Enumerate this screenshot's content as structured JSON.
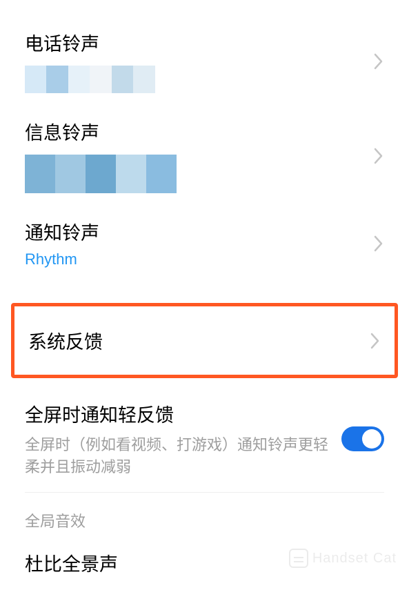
{
  "rows": {
    "phone_ringtone": {
      "title": "电话铃声"
    },
    "sms_ringtone": {
      "title": "信息铃声"
    },
    "notification_ringtone": {
      "title": "通知铃声",
      "subtitle": "Rhythm"
    },
    "system_feedback": {
      "title": "系统反馈"
    },
    "fullscreen_feedback": {
      "title": "全屏时通知轻反馈",
      "desc": "全屏时（例如看视频、打游戏）通知铃声更轻柔并且振动减弱",
      "toggle": true
    },
    "dolby": {
      "title": "杜比全景声"
    }
  },
  "sections": {
    "global_sound": "全局音效"
  },
  "watermark": "Handset Cat"
}
